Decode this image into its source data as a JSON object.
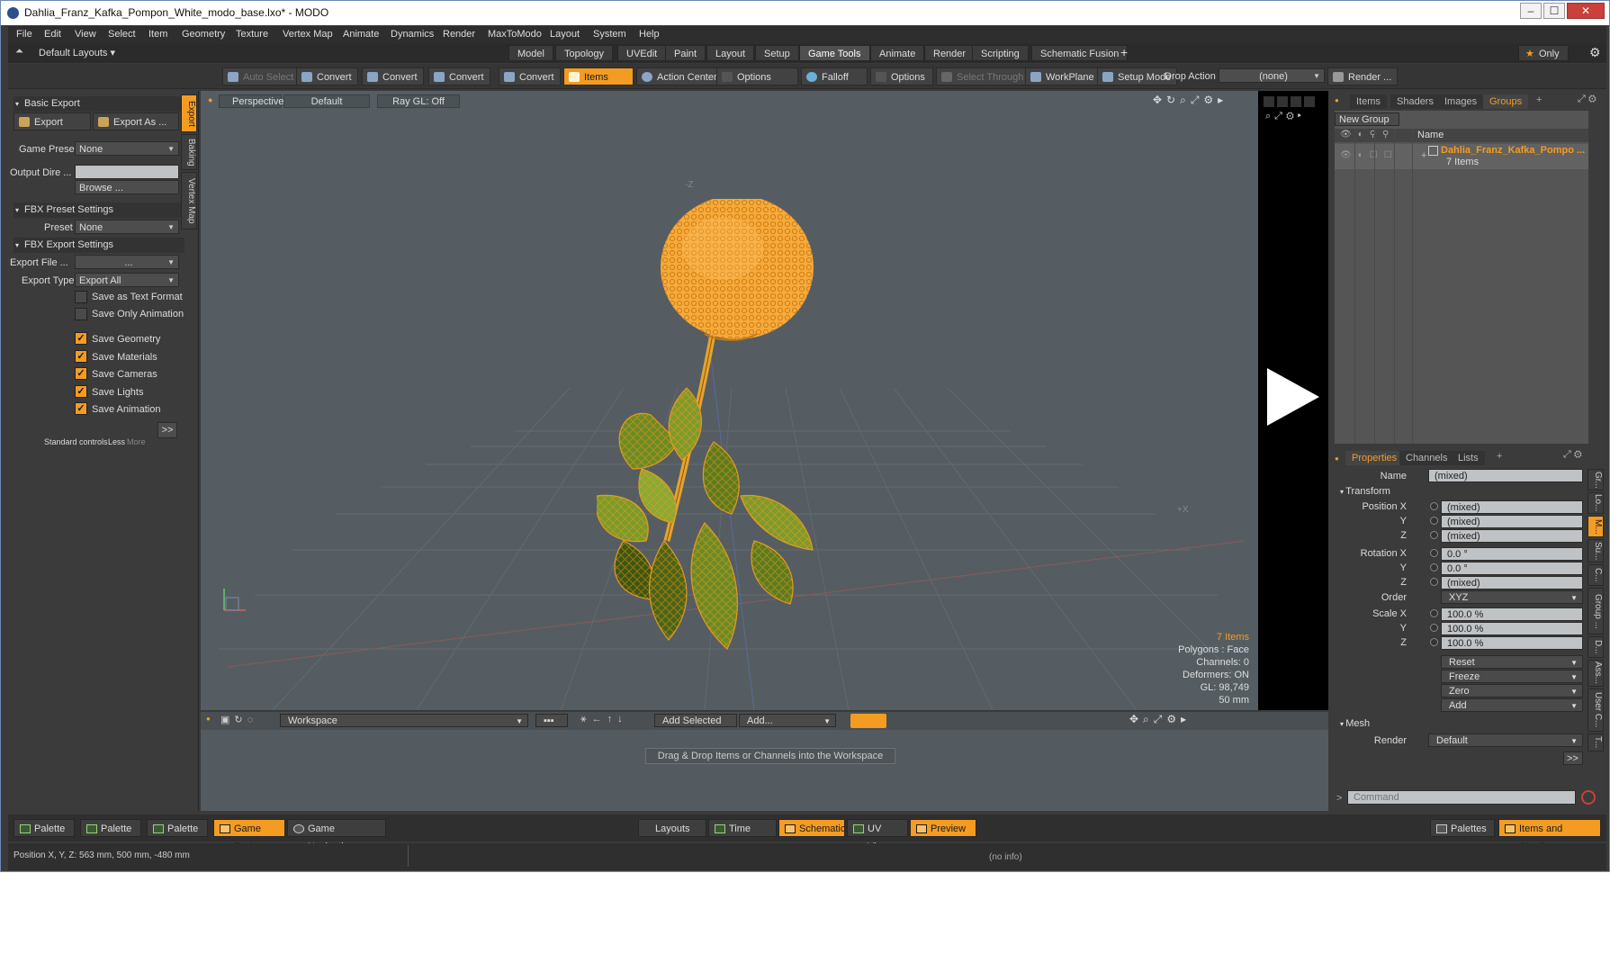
{
  "window": {
    "title": "Dahlia_Franz_Kafka_Pompon_White_modo_base.lxo* - MODO",
    "min": "–",
    "max": "☐",
    "close": "✕"
  },
  "menu": [
    "File",
    "Edit",
    "View",
    "Select",
    "Item",
    "Geometry",
    "Texture",
    "Vertex Map",
    "Animate",
    "Dynamics",
    "Render",
    "MaxToModo",
    "Layout",
    "System",
    "Help"
  ],
  "layouts_label": "Default Layouts",
  "tabs": [
    "Model",
    "Topology",
    "UVEdit",
    "Paint",
    "Layout",
    "Setup",
    "Game Tools",
    "Animate",
    "Render",
    "Scripting",
    "Schematic Fusion"
  ],
  "active_tab": "Game Tools",
  "only_label": "Only",
  "toolbar": {
    "auto_select": "Auto Select",
    "convert1": "Convert",
    "convert2": "Convert",
    "convert3": "Convert",
    "convert4": "Convert",
    "items": "Items",
    "action_center": "Action Center",
    "options1": "Options",
    "falloff": "Falloff",
    "options2": "Options",
    "select_through": "Select Through",
    "workplane": "WorkPlane",
    "setup_mode": "Setup Mode",
    "drop_action": "Drop Action",
    "drop_value": "(none)",
    "render": "Render ..."
  },
  "left": {
    "basic_export": "Basic Export",
    "export": "Export",
    "export_as": "Export As ...",
    "game_preset_label": "Game Preset",
    "game_preset_value": "None",
    "output_dir_label": "Output Dire ...",
    "browse": "Browse ...",
    "fbx_preset": "FBX Preset Settings",
    "preset_label": "Preset",
    "preset_value": "None",
    "fbx_export": "FBX Export Settings",
    "export_file_label": "Export File ...",
    "export_file_value": "...",
    "export_type_label": "Export Type",
    "export_type_value": "Export All",
    "checks": [
      {
        "label": "Save as Text Format",
        "on": false
      },
      {
        "label": "Save Only Animation",
        "on": false
      },
      {
        "label": "Save Geometry",
        "on": true
      },
      {
        "label": "Save Materials",
        "on": true
      },
      {
        "label": "Save Cameras",
        "on": true
      },
      {
        "label": "Save Lights",
        "on": true
      },
      {
        "label": "Save Animation",
        "on": true
      }
    ],
    "more_btn": ">>",
    "standard_controls": "Standard controls",
    "less": "Less",
    "more": "More",
    "vtabs": [
      "Export",
      "Baking",
      "Vertex Map"
    ]
  },
  "viewport": {
    "perspective": "Perspective",
    "default": "Default",
    "raygl": "Ray GL: Off",
    "axis_z": "-Z",
    "axis_x": "+X",
    "info": {
      "items": "7 Items",
      "polygons": "Polygons : Face",
      "channels": "Channels: 0",
      "deformers": "Deformers: ON",
      "gl": "GL: 98,749",
      "focal": "50 mm"
    }
  },
  "workspace": {
    "name": "Workspace",
    "add_selected": "Add Selected",
    "add": "Add...",
    "hint": "Drag & Drop Items or Channels into the Workspace"
  },
  "groups": {
    "tabs": [
      "Items",
      "Shaders",
      "Images",
      "Groups"
    ],
    "active": "Groups",
    "new_group": "New Group",
    "name_col": "Name",
    "item_name": "Dahlia_Franz_Kafka_Pompo ...",
    "item_count": "7 Items"
  },
  "properties": {
    "tabs": [
      "Properties",
      "Channels",
      "Lists"
    ],
    "name_label": "Name",
    "name_value": "(mixed)",
    "transform": "Transform",
    "rows": [
      {
        "label": "Position X",
        "value": "(mixed)"
      },
      {
        "label": "Y",
        "value": "(mixed)"
      },
      {
        "label": "Z",
        "value": "(mixed)"
      },
      {
        "label": "Rotation X",
        "value": "0.0 °"
      },
      {
        "label": "Y",
        "value": "0.0 °"
      },
      {
        "label": "Z",
        "value": "(mixed)"
      }
    ],
    "order_label": "Order",
    "order_value": "XYZ",
    "scale": [
      {
        "label": "Scale X",
        "value": "100.0 %"
      },
      {
        "label": "Y",
        "value": "100.0 %"
      },
      {
        "label": "Z",
        "value": "100.0 %"
      }
    ],
    "buttons": [
      "Reset",
      "Freeze",
      "Zero",
      "Add"
    ],
    "mesh": "Mesh",
    "render_label": "Render",
    "render_value": "Default",
    "more_btn": ">>",
    "side_tabs": [
      "Gr...",
      "Lo...",
      "M...",
      "Su...",
      "C...",
      "Group ...",
      "D...",
      "Ass...",
      "User C...",
      "T..."
    ],
    "command_placeholder": "Command"
  },
  "bottom": {
    "palette1": "Palette",
    "palette2": "Palette",
    "palette3": "Palette",
    "game_tools": "Game Tools",
    "game_navigation": "Game Navigation",
    "layouts": "Layouts",
    "time": "Time",
    "schematic": "Schematic",
    "uv_view": "UV View",
    "preview": "Preview",
    "palettes": "Palettes",
    "items_shading": "Items and Shading"
  },
  "status": {
    "position": "Position X, Y, Z:  563 mm, 500 mm, -480 mm",
    "info": "(no info)"
  },
  "colors": {
    "accent": "#f39c21",
    "background": "#3a3a3a",
    "viewport": "#555d62"
  }
}
